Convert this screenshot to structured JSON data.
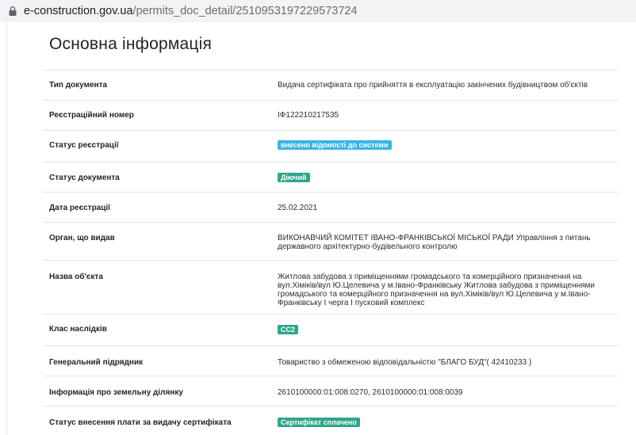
{
  "browser": {
    "url_host": "e-construction.gov.ua",
    "url_path": "/permits_doc_detail/2510953197229573724"
  },
  "section": {
    "title": "Основна інформація"
  },
  "rows": [
    {
      "label": "Тип документа",
      "value": "Видача сертифіката про прийняття в експлуатацію закінчених будівництвом об'єктів"
    },
    {
      "label": "Реєстраційний номер",
      "value": "ІФ122210217535"
    },
    {
      "label": "Статус реєстрації",
      "badge": "внесено відомості до системи",
      "badge_color": "#3cb4e5"
    },
    {
      "label": "Статус документа",
      "badge": "Діючий",
      "badge_color": "#2fa58c"
    },
    {
      "label": "Дата реєстрації",
      "value": "25.02.2021"
    },
    {
      "label": "Орган, що видав",
      "value": "ВИКОНАВЧИЙ КОМІТЕТ ІВАНО-ФРАНКІВСЬКОЇ МІСЬКОЇ РАДИ Управління з питань державного архітектурно-будівельного контролю"
    },
    {
      "label": "Назва об'єкта",
      "value": "Житлова забудова з приміщеннями громадського та комерційного призначення на вул.Хіміків/вул Ю.Целевича у м.Івано-Франківську Житлова забудова з приміщеннями громадського та комерційного призначення на вул.Хіміків/вул Ю.Целевича у м.Івано-Франківську І черга І пусковий комплекс"
    },
    {
      "label": "Клас наслідків",
      "badge": "СС2",
      "badge_color": "#2fa58c"
    },
    {
      "label": "Генеральний підрядник",
      "value": "Товариство з обмеженою відповідальністю \"БЛАГО БУД\"( 42410233 )"
    },
    {
      "label": "Інформація про земельну ділянку",
      "value": "2610100000:01:008:0270, 2610100000:01:008:0039"
    },
    {
      "label": "Статус внесення плати за видачу сертифіката",
      "badge": "Сертифікат сплачено",
      "badge_color": "#2fa58c"
    }
  ]
}
